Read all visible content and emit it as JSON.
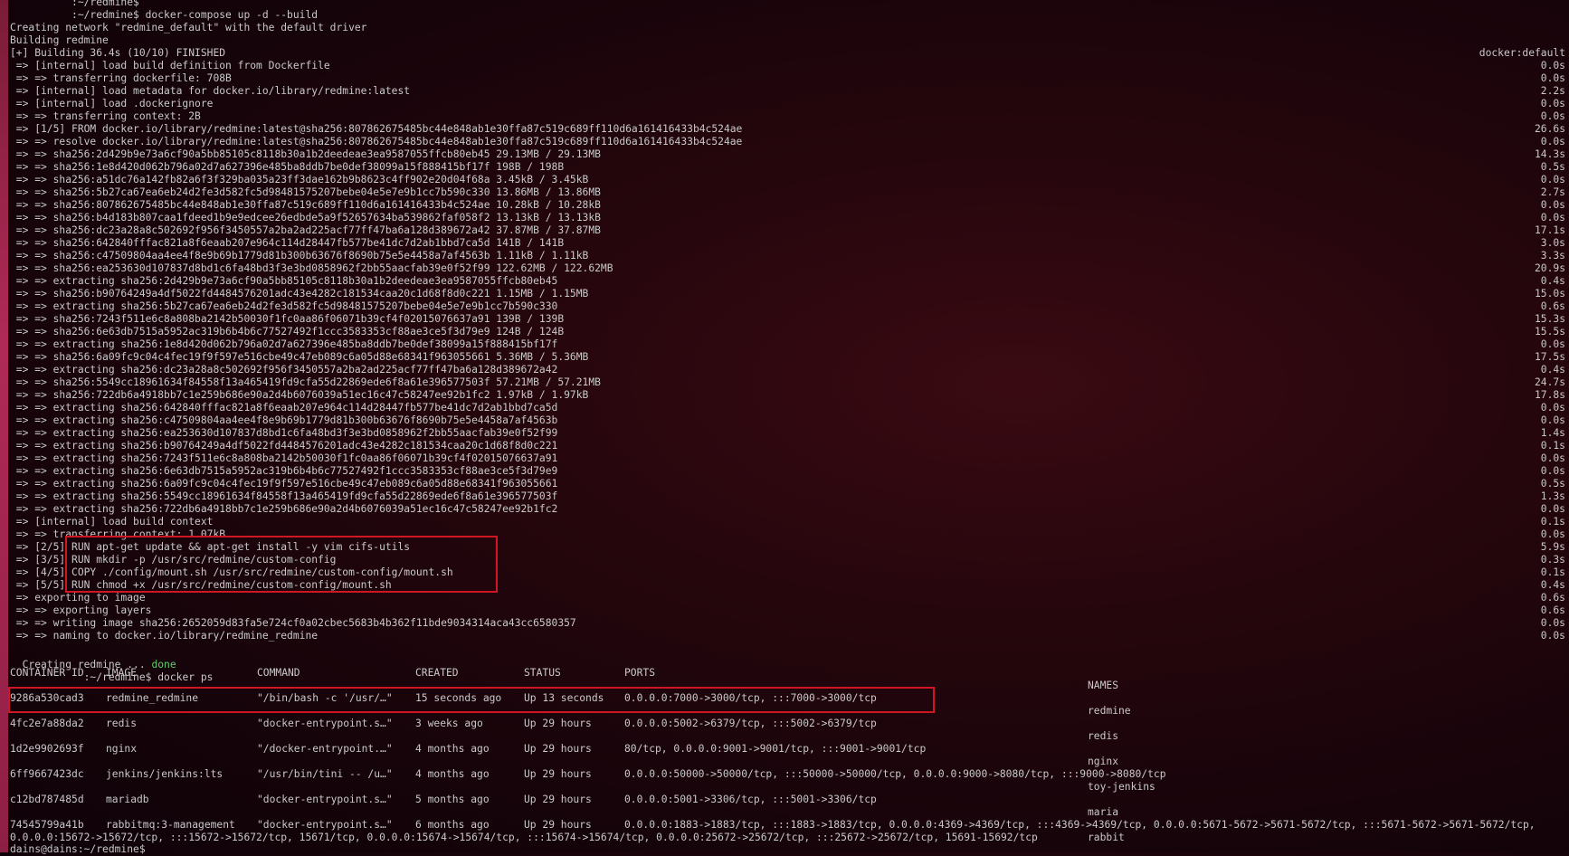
{
  "lines": [
    {
      "text": "          :~/redmine$",
      "time": ""
    },
    {
      "text": "          :~/redmine$ docker-compose up -d --build",
      "time": ""
    },
    {
      "text": "Creating network \"redmine_default\" with the default driver",
      "time": ""
    },
    {
      "text": "Building redmine",
      "time": ""
    },
    {
      "text": "[+] Building 36.4s (10/10) FINISHED",
      "time": "docker:default"
    },
    {
      "text": " => [internal] load build definition from Dockerfile",
      "time": "0.0s"
    },
    {
      "text": " => => transferring dockerfile: 708B",
      "time": "0.0s"
    },
    {
      "text": " => [internal] load metadata for docker.io/library/redmine:latest",
      "time": "2.2s"
    },
    {
      "text": " => [internal] load .dockerignore",
      "time": "0.0s"
    },
    {
      "text": " => => transferring context: 2B",
      "time": "0.0s"
    },
    {
      "text": " => [1/5] FROM docker.io/library/redmine:latest@sha256:807862675485bc44e848ab1e30ffa87c519c689ff110d6a161416433b4c524ae",
      "time": "26.6s"
    },
    {
      "text": " => => resolve docker.io/library/redmine:latest@sha256:807862675485bc44e848ab1e30ffa87c519c689ff110d6a161416433b4c524ae",
      "time": "0.0s"
    },
    {
      "text": " => => sha256:2d429b9e73a6cf90a5bb85105c8118b30a1b2deedeae3ea9587055ffcb80eb45 29.13MB / 29.13MB",
      "time": "14.3s"
    },
    {
      "text": " => => sha256:1e8d420d062b796a02d7a627396e485ba8ddb7be0def38099a15f888415bf17f 198B / 198B",
      "time": "0.5s"
    },
    {
      "text": " => => sha256:a51dc76a142fb82a6f3f329ba035a23ff3dae162b9b8623c4ff902e20d04f68a 3.45kB / 3.45kB",
      "time": "0.0s"
    },
    {
      "text": " => => sha256:5b27ca67ea6eb24d2fe3d582fc5d98481575207bebe04e5e7e9b1cc7b590c330 13.86MB / 13.86MB",
      "time": "2.7s"
    },
    {
      "text": " => => sha256:807862675485bc44e848ab1e30ffa87c519c689ff110d6a161416433b4c524ae 10.28kB / 10.28kB",
      "time": "0.0s"
    },
    {
      "text": " => => sha256:b4d183b807caa1fdeed1b9e9edcee26edbde5a9f52657634ba539862faf058f2 13.13kB / 13.13kB",
      "time": "0.0s"
    },
    {
      "text": " => => sha256:dc23a28a8c502692f956f3450557a2ba2ad225acf77ff47ba6a128d389672a42 37.87MB / 37.87MB",
      "time": "17.1s"
    },
    {
      "text": " => => sha256:642840fffac821a8f6eaab207e964c114d28447fb577be41dc7d2ab1bbd7ca5d 141B / 141B",
      "time": "3.0s"
    },
    {
      "text": " => => sha256:c47509804aa4ee4f8e9b69b1779d81b300b63676f8690b75e5e4458a7af4563b 1.11kB / 1.11kB",
      "time": "3.3s"
    },
    {
      "text": " => => sha256:ea253630d107837d8bd1c6fa48bd3f3e3bd0858962f2bb55aacfab39e0f52f99 122.62MB / 122.62MB",
      "time": "20.9s"
    },
    {
      "text": " => => extracting sha256:2d429b9e73a6cf90a5bb85105c8118b30a1b2deedeae3ea9587055ffcb80eb45",
      "time": "0.4s"
    },
    {
      "text": " => => sha256:b90764249a4df5022fd4484576201adc43e4282c181534caa20c1d68f8d0c221 1.15MB / 1.15MB",
      "time": "15.0s"
    },
    {
      "text": " => => extracting sha256:5b27ca67ea6eb24d2fe3d582fc5d98481575207bebe04e5e7e9b1cc7b590c330",
      "time": "0.6s"
    },
    {
      "text": " => => sha256:7243f511e6c8a808ba2142b50030f1fc0aa86f06071b39cf4f02015076637a91 139B / 139B",
      "time": "15.3s"
    },
    {
      "text": " => => sha256:6e63db7515a5952ac319b6b4b6c77527492f1ccc3583353cf88ae3ce5f3d79e9 124B / 124B",
      "time": "15.5s"
    },
    {
      "text": " => => extracting sha256:1e8d420d062b796a02d7a627396e485ba8ddb7be0def38099a15f888415bf17f",
      "time": "0.0s"
    },
    {
      "text": " => => sha256:6a09fc9c04c4fec19f9f597e516cbe49c47eb089c6a05d88e68341f963055661 5.36MB / 5.36MB",
      "time": "17.5s"
    },
    {
      "text": " => => extracting sha256:dc23a28a8c502692f956f3450557a2ba2ad225acf77ff47ba6a128d389672a42",
      "time": "0.4s"
    },
    {
      "text": " => => sha256:5549cc18961634f84558f13a465419fd9cfa55d22869ede6f8a61e396577503f 57.21MB / 57.21MB",
      "time": "24.7s"
    },
    {
      "text": " => => sha256:722db6a4918bb7c1e259b686e90a2d4b6076039a51ec16c47c58247ee92b1fc2 1.97kB / 1.97kB",
      "time": "17.8s"
    },
    {
      "text": " => => extracting sha256:642840fffac821a8f6eaab207e964c114d28447fb577be41dc7d2ab1bbd7ca5d",
      "time": "0.0s"
    },
    {
      "text": " => => extracting sha256:c47509804aa4ee4f8e9b69b1779d81b300b63676f8690b75e5e4458a7af4563b",
      "time": "0.0s"
    },
    {
      "text": " => => extracting sha256:ea253630d107837d8bd1c6fa48bd3f3e3bd0858962f2bb55aacfab39e0f52f99",
      "time": "1.4s"
    },
    {
      "text": " => => extracting sha256:b90764249a4df5022fd4484576201adc43e4282c181534caa20c1d68f8d0c221",
      "time": "0.1s"
    },
    {
      "text": " => => extracting sha256:7243f511e6c8a808ba2142b50030f1fc0aa86f06071b39cf4f02015076637a91",
      "time": "0.0s"
    },
    {
      "text": " => => extracting sha256:6e63db7515a5952ac319b6b4b6c77527492f1ccc3583353cf88ae3ce5f3d79e9",
      "time": "0.0s"
    },
    {
      "text": " => => extracting sha256:6a09fc9c04c4fec19f9f597e516cbe49c47eb089c6a05d88e68341f963055661",
      "time": "0.5s"
    },
    {
      "text": " => => extracting sha256:5549cc18961634f84558f13a465419fd9cfa55d22869ede6f8a61e396577503f",
      "time": "1.3s"
    },
    {
      "text": " => => extracting sha256:722db6a4918bb7c1e259b686e90a2d4b6076039a51ec16c47c58247ee92b1fc2",
      "time": "0.0s"
    },
    {
      "text": " => [internal] load build context",
      "time": "0.1s"
    },
    {
      "text": " => => transferring context: 1.07kB",
      "time": "0.0s"
    },
    {
      "text": " => [2/5] RUN apt-get update && apt-get install -y vim cifs-utils",
      "time": "5.9s"
    },
    {
      "text": " => [3/5] RUN mkdir -p /usr/src/redmine/custom-config",
      "time": "0.3s"
    },
    {
      "text": " => [4/5] COPY ./config/mount.sh /usr/src/redmine/custom-config/mount.sh",
      "time": "0.1s"
    },
    {
      "text": " => [5/5] RUN chmod +x /usr/src/redmine/custom-config/mount.sh",
      "time": "0.4s"
    },
    {
      "text": " => exporting to image",
      "time": "0.6s"
    },
    {
      "text": " => => exporting layers",
      "time": "0.6s"
    },
    {
      "text": " => => writing image sha256:2652059d83fa5e724cf0a02cbec5683b4b362f11bde9034314aca43cc6580357",
      "time": "0.0s"
    },
    {
      "text": " => => naming to docker.io/library/redmine_redmine",
      "time": "0.0s"
    }
  ],
  "creating": {
    "prefix": "Creating redmine ... ",
    "status": "done"
  },
  "ps_prompt": "          :~/redmine$ docker ps",
  "ps": {
    "headers": {
      "id": "CONTAINER ID",
      "image": "IMAGE",
      "command": "COMMAND",
      "created": "CREATED",
      "status": "STATUS",
      "ports": "PORTS",
      "names": "NAMES"
    },
    "rows": [
      {
        "id": "9286a530cad3",
        "image": "redmine_redmine",
        "command": "\"/bin/bash -c '/usr/…\"",
        "created": "15 seconds ago",
        "status": "Up 13 seconds",
        "ports": "0.0.0.0:7000->3000/tcp, :::7000->3000/tcp",
        "ports2": "",
        "name": "redmine"
      },
      {
        "id": "4fc2e7a88da2",
        "image": "redis",
        "command": "\"docker-entrypoint.s…\"",
        "created": "3 weeks ago",
        "status": "Up 29 hours",
        "ports": "0.0.0.0:5002->6379/tcp, :::5002->6379/tcp",
        "ports2": "",
        "name": "redis"
      },
      {
        "id": "1d2e9902693f",
        "image": "nginx",
        "command": "\"/docker-entrypoint.…\"",
        "created": "4 months ago",
        "status": "Up 29 hours",
        "ports": "80/tcp, 0.0.0.0:9001->9001/tcp, :::9001->9001/tcp",
        "ports2": "",
        "name": "nginx"
      },
      {
        "id": "6ff9667423dc",
        "image": "jenkins/jenkins:lts",
        "command": "\"/usr/bin/tini -- /u…\"",
        "created": "4 months ago",
        "status": "Up 29 hours",
        "ports": "0.0.0.0:50000->50000/tcp, :::50000->50000/tcp, 0.0.0.0:9000->8080/tcp, :::9000->8080/tcp",
        "ports2": "",
        "name": "toy-jenkins"
      },
      {
        "id": "c12bd787485d",
        "image": "mariadb",
        "command": "\"docker-entrypoint.s…\"",
        "created": "5 months ago",
        "status": "Up 29 hours",
        "ports": "0.0.0.0:5001->3306/tcp, :::5001->3306/tcp",
        "ports2": "",
        "name": "maria"
      },
      {
        "id": "74545799a41b",
        "image": "rabbitmq:3-management",
        "command": "\"docker-entrypoint.s…\"",
        "created": "6 months ago",
        "status": "Up 29 hours",
        "ports": "0.0.0.0:1883->1883/tcp, :::1883->1883/tcp, 0.0.0.0:4369->4369/tcp, :::4369->4369/tcp, 0.0.0.0:5671-5672->5671-5672/tcp, :::5671-5672->5671-5672/tcp,",
        "ports2": "0.0.0.0:15672->15672/tcp, :::15672->15672/tcp, 15671/tcp, 0.0.0.0:15674->15674/tcp, :::15674->15674/tcp, 0.0.0.0:25672->25672/tcp, :::25672->25672/tcp, 15691-15692/tcp",
        "name": "rabbit"
      }
    ]
  },
  "last_prompt": "dains@dains:~/redmine$",
  "colors": {
    "highlight": "#d01622",
    "done": "#5fcf6a",
    "background": "#1e050b"
  }
}
